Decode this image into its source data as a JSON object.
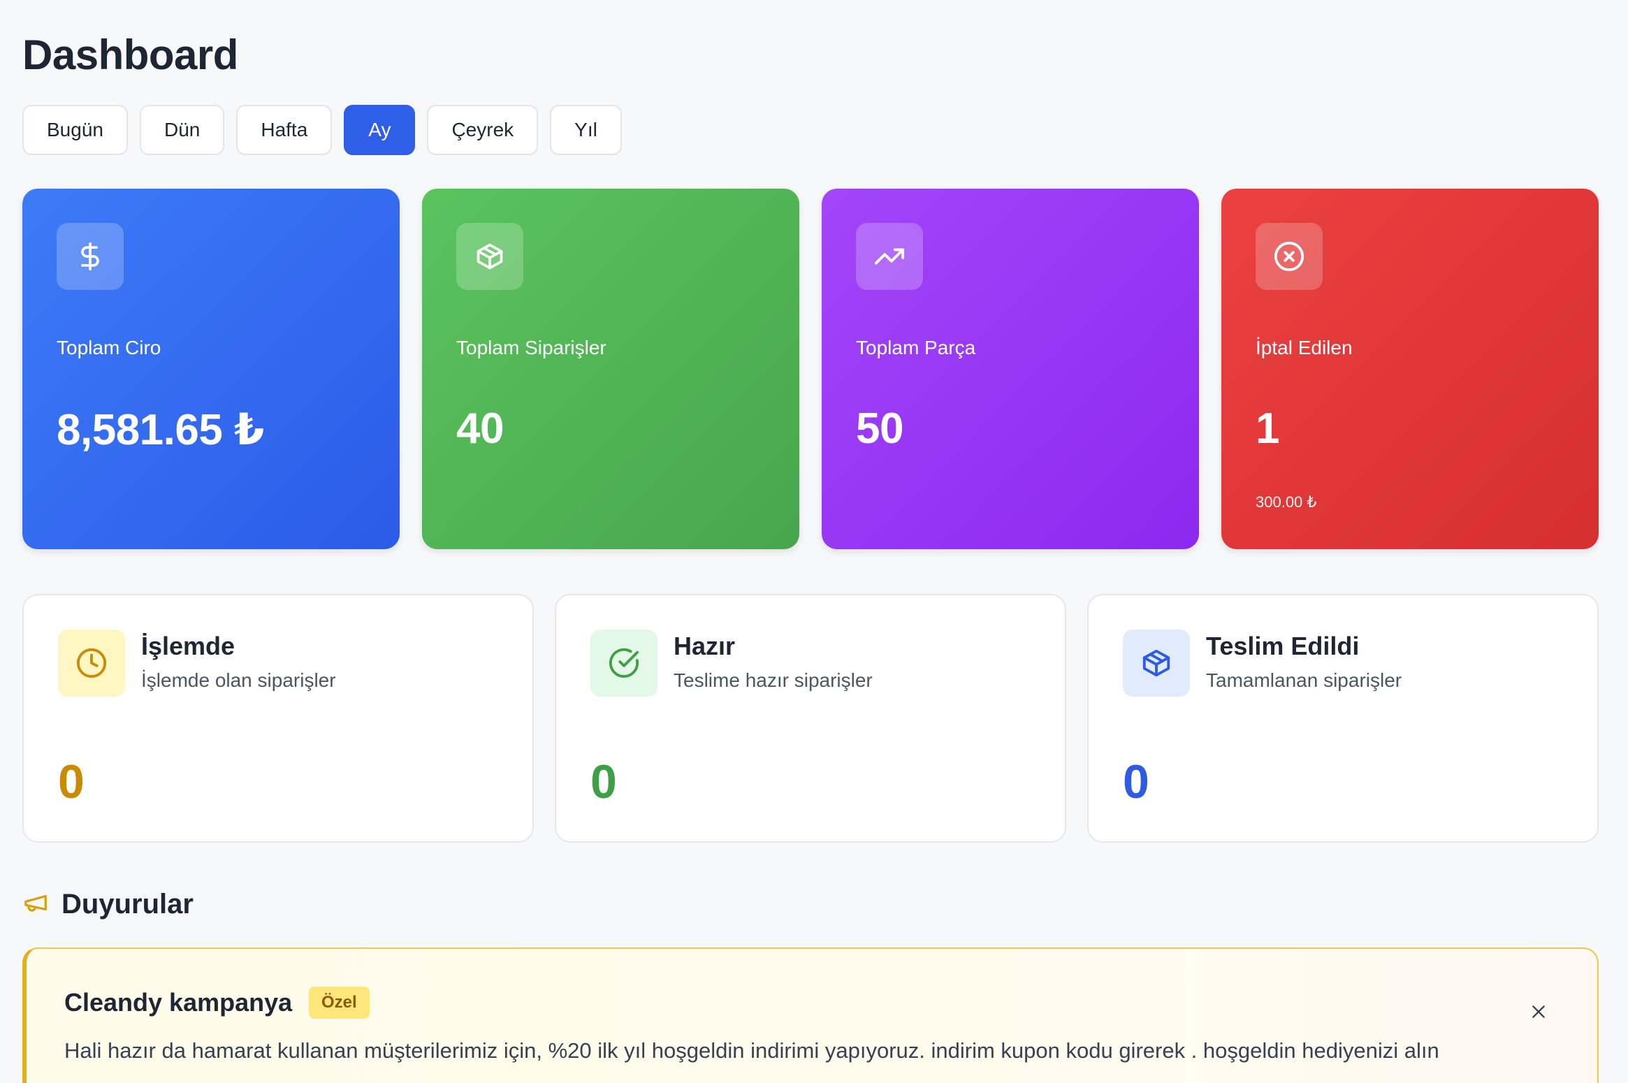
{
  "page": {
    "title": "Dashboard"
  },
  "periods": [
    {
      "label": "Bugün",
      "active": false
    },
    {
      "label": "Dün",
      "active": false
    },
    {
      "label": "Hafta",
      "active": false
    },
    {
      "label": "Ay",
      "active": true
    },
    {
      "label": "Çeyrek",
      "active": false
    },
    {
      "label": "Yıl",
      "active": false
    }
  ],
  "stats": [
    {
      "label": "Toplam Ciro",
      "value": "8,581.65 ₺",
      "sub": "",
      "icon": "dollar-icon",
      "color": "#3b72f5"
    },
    {
      "label": "Toplam Siparişler",
      "value": "40",
      "sub": "",
      "icon": "box-icon",
      "color": "#51b555"
    },
    {
      "label": "Toplam Parça",
      "value": "50",
      "sub": "",
      "icon": "trending-up-icon",
      "color": "#9a3cf6"
    },
    {
      "label": "İptal Edilen",
      "value": "1",
      "sub": "300.00 ₺",
      "icon": "x-circle-icon",
      "color": "#e03a3a"
    }
  ],
  "statuses": [
    {
      "title": "İşlemde",
      "description": "İşlemde olan siparişler",
      "value": "0",
      "icon": "clock-icon",
      "color": "#ca8a04",
      "bg": "#fef6c3"
    },
    {
      "title": "Hazır",
      "description": "Teslime hazır siparişler",
      "value": "0",
      "icon": "check-circle-icon",
      "color": "#3ea046",
      "bg": "#e3f8e6"
    },
    {
      "title": "Teslim Edildi",
      "description": "Tamamlanan siparişler",
      "value": "0",
      "icon": "box-icon",
      "color": "#2d5be3",
      "bg": "#e1ebfd"
    }
  ],
  "announcements": {
    "heading": "Duyurular",
    "icon": "megaphone-icon",
    "items": [
      {
        "title": "Cleandy kampanya",
        "badge": "Özel",
        "body": "Hali hazır da hamarat kullanan müşterilerimiz için, %20 ilk yıl hoşgeldin indirimi yapıyoruz. indirim kupon kodu girerek . hoşgeldin hediyenizi alın"
      }
    ]
  }
}
